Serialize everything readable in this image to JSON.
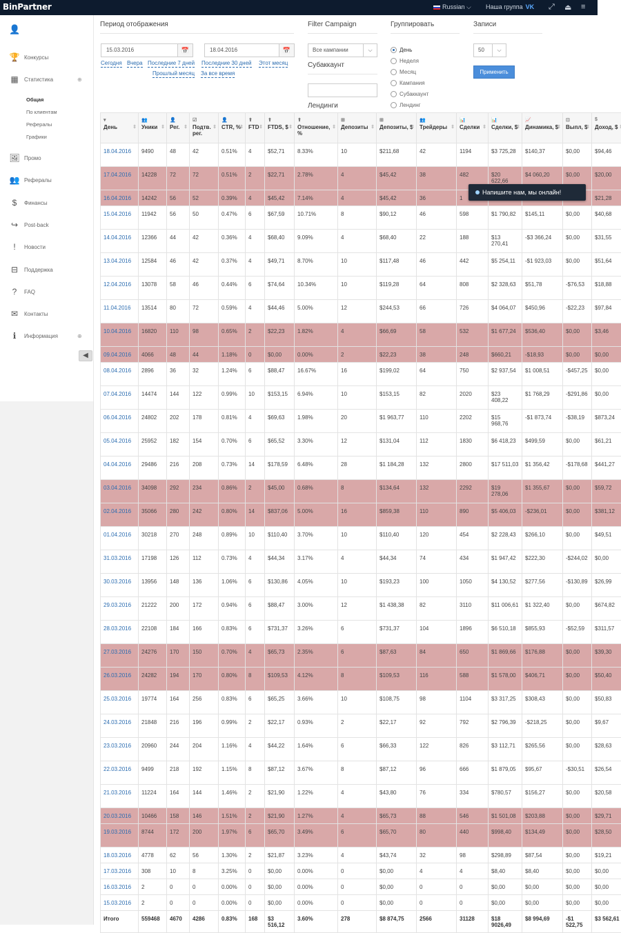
{
  "header": {
    "logo": "BinPartner",
    "language": "Russian",
    "group_label": "Наша группа",
    "vk": "VK"
  },
  "icons": {
    "fullscreen": "expand-icon",
    "logout": "logout-icon",
    "menu": "hamburger-icon"
  },
  "sidebar": {
    "items": [
      {
        "label": "Конкурсы",
        "icon": "trophy-icon",
        "glyph": "🏆"
      },
      {
        "label": "Статистика",
        "icon": "table-icon",
        "glyph": "▦",
        "expandable": "⊕"
      },
      {
        "label": "Промо",
        "icon": "image-icon",
        "glyph": "🖼"
      },
      {
        "label": "Рефералы",
        "icon": "users-icon",
        "glyph": "👥"
      },
      {
        "label": "Финансы",
        "icon": "dollar-icon",
        "glyph": "$"
      },
      {
        "label": "Post-back",
        "icon": "share-icon",
        "glyph": "↪"
      },
      {
        "label": "Новости",
        "icon": "exclamation-icon",
        "glyph": "!"
      },
      {
        "label": "Поддержка",
        "icon": "inbox-icon",
        "glyph": "⊟"
      },
      {
        "label": "FAQ",
        "icon": "question-icon",
        "glyph": "?"
      },
      {
        "label": "Контакты",
        "icon": "envelope-icon",
        "glyph": "✉"
      },
      {
        "label": "Информация",
        "icon": "info-icon",
        "glyph": "ℹ",
        "expandable": "⊕"
      }
    ],
    "subitems": [
      "Общая",
      "По клиентам",
      "Рефералы",
      "Графики"
    ],
    "collapse_glyph": "◀"
  },
  "filters": {
    "period_label": "Период отображения",
    "date_from": "15.03.2016",
    "date_to": "18.04.2016",
    "calendar_glyph": "📅",
    "period_links": [
      "Сегодня",
      "Вчера",
      "Последние 7 дней",
      "Последние 30 дней",
      "Этот месяц",
      "Прошлый месяц",
      "За все время"
    ],
    "campaign_label": "Filter Campaign",
    "campaign_value": "Все кампании",
    "subaccount_label": "Субаккаунт",
    "landing_label": "Лендинги",
    "group_label": "Группировать",
    "group_options": [
      "День",
      "Неделя",
      "Месяц",
      "Кампания",
      "Субаккаунт",
      "Лендинг"
    ],
    "group_selected": "День",
    "records_label": "Записи",
    "records_value": "50",
    "apply_label": "Применить"
  },
  "chat": {
    "label": "Напишите нам, мы онлайн!"
  },
  "table": {
    "columns": [
      {
        "label": "День",
        "icon": "▾"
      },
      {
        "label": "Уники",
        "icon": "👥"
      },
      {
        "label": "Рег.",
        "icon": "👤"
      },
      {
        "label": "Подтв. рег.",
        "icon": "☑"
      },
      {
        "label": "CTR, %",
        "icon": "👤"
      },
      {
        "label": "FTD",
        "icon": "⬆"
      },
      {
        "label": "FTDS, $",
        "icon": "⬆"
      },
      {
        "label": "Отношение, %",
        "icon": "⬆"
      },
      {
        "label": "Депозиты",
        "icon": "⊞"
      },
      {
        "label": "Депозиты, $",
        "icon": "⊞"
      },
      {
        "label": "Трейдеры",
        "icon": "👥"
      },
      {
        "label": "Сделки",
        "icon": "📊"
      },
      {
        "label": "Сделки, $",
        "icon": "📊"
      },
      {
        "label": "Динамика, $",
        "icon": "📈"
      },
      {
        "label": "Выпл, $",
        "icon": "⊡"
      },
      {
        "label": "Доход, $",
        "icon": "$"
      }
    ],
    "rows": [
      {
        "red": false,
        "cells": [
          "18.04.2016",
          "9490",
          "48",
          "42",
          "0.51%",
          "4",
          "$52,71",
          "8.33%",
          "10",
          "$211,68",
          "42",
          "1194",
          "$3 725,28",
          "$140,37",
          "$0,00",
          "$94,46"
        ]
      },
      {
        "red": true,
        "cells": [
          "17.04.2016",
          "14228",
          "72",
          "72",
          "0.51%",
          "2",
          "$22,71",
          "2.78%",
          "4",
          "$45,42",
          "38",
          "482",
          "$20 622,66",
          "$4 060,20",
          "$0,00",
          "$20,00"
        ]
      },
      {
        "red": true,
        "cells": [
          "16.04.2016",
          "14242",
          "56",
          "52",
          "0.39%",
          "4",
          "$45,42",
          "7.14%",
          "4",
          "$45,42",
          "36",
          "1",
          "",
          "",
          "",
          "$21,28"
        ]
      },
      {
        "red": false,
        "cells": [
          "15.04.2016",
          "11942",
          "56",
          "50",
          "0.47%",
          "6",
          "$67,59",
          "10.71%",
          "8",
          "$90,12",
          "46",
          "598",
          "$1 790,82",
          "$145,11",
          "$0,00",
          "$40,68"
        ]
      },
      {
        "red": false,
        "cells": [
          "14.04.2016",
          "12366",
          "44",
          "42",
          "0.36%",
          "4",
          "$68,40",
          "9.09%",
          "4",
          "$68,40",
          "22",
          "188",
          "$13 270,41",
          "-$3 366,24",
          "$0,00",
          "$31,55"
        ]
      },
      {
        "red": false,
        "cells": [
          "13.04.2016",
          "12584",
          "46",
          "42",
          "0.37%",
          "4",
          "$49,71",
          "8.70%",
          "10",
          "$117,48",
          "46",
          "442",
          "$5 254,11",
          "-$1 923,03",
          "$0,00",
          "$51,64"
        ]
      },
      {
        "red": false,
        "cells": [
          "12.04.2016",
          "13078",
          "58",
          "46",
          "0.44%",
          "6",
          "$74,64",
          "10.34%",
          "10",
          "$119,28",
          "64",
          "808",
          "$2 328,63",
          "$51,78",
          "-$76,53",
          "$18,88"
        ]
      },
      {
        "red": false,
        "cells": [
          "11.04.2016",
          "13514",
          "80",
          "72",
          "0.59%",
          "4",
          "$44,46",
          "5.00%",
          "12",
          "$244,53",
          "66",
          "726",
          "$4 064,07",
          "$450,96",
          "-$22,23",
          "$97,84"
        ]
      },
      {
        "red": true,
        "cells": [
          "10.04.2016",
          "16820",
          "110",
          "98",
          "0.65%",
          "2",
          "$22,23",
          "1.82%",
          "4",
          "$66,69",
          "58",
          "532",
          "$1 677,24",
          "$536,40",
          "$0,00",
          "$3,46"
        ]
      },
      {
        "red": true,
        "cells": [
          "09.04.2016",
          "4066",
          "48",
          "44",
          "1.18%",
          "0",
          "$0,00",
          "0.00%",
          "2",
          "$22,23",
          "38",
          "248",
          "$660,21",
          "-$18,93",
          "$0,00",
          "$0,00"
        ]
      },
      {
        "red": false,
        "cells": [
          "08.04.2016",
          "2896",
          "36",
          "32",
          "1.24%",
          "6",
          "$88,47",
          "16.67%",
          "16",
          "$199,02",
          "64",
          "750",
          "$2 937,54",
          "$1 008,51",
          "-$457,25",
          "$0,00"
        ]
      },
      {
        "red": false,
        "cells": [
          "07.04.2016",
          "14474",
          "144",
          "122",
          "0.99%",
          "10",
          "$153,15",
          "6.94%",
          "10",
          "$153,15",
          "82",
          "2020",
          "$23 408,22",
          "$1 768,29",
          "-$291,86",
          "$0,00"
        ]
      },
      {
        "red": false,
        "cells": [
          "06.04.2016",
          "24802",
          "202",
          "178",
          "0.81%",
          "4",
          "$69,63",
          "1.98%",
          "20",
          "$1 963,77",
          "110",
          "2202",
          "$15 968,76",
          "-$1 873,74",
          "-$38,19",
          "$873,24"
        ]
      },
      {
        "red": false,
        "cells": [
          "05.04.2016",
          "25952",
          "182",
          "154",
          "0.70%",
          "6",
          "$65,52",
          "3.30%",
          "12",
          "$131,04",
          "112",
          "1830",
          "$6 418,23",
          "$499,59",
          "$0,00",
          "$61,21"
        ]
      },
      {
        "red": false,
        "cells": [
          "04.04.2016",
          "29486",
          "216",
          "208",
          "0.73%",
          "14",
          "$178,59",
          "6.48%",
          "28",
          "$1 184,28",
          "132",
          "2800",
          "$17 511,03",
          "$1 356,42",
          "-$178,68",
          "$441,27"
        ]
      },
      {
        "red": true,
        "cells": [
          "03.04.2016",
          "34098",
          "292",
          "234",
          "0.86%",
          "2",
          "$45,00",
          "0.68%",
          "8",
          "$134,64",
          "132",
          "2292",
          "$19 278,06",
          "$1 355,67",
          "$0,00",
          "$59,72"
        ]
      },
      {
        "red": true,
        "cells": [
          "02.04.2016",
          "35066",
          "280",
          "242",
          "0.80%",
          "14",
          "$837,06",
          "5.00%",
          "16",
          "$859,38",
          "110",
          "890",
          "$5 406,03",
          "-$236,01",
          "$0,00",
          "$381,12"
        ]
      },
      {
        "red": false,
        "cells": [
          "01.04.2016",
          "30218",
          "270",
          "248",
          "0.89%",
          "10",
          "$110,40",
          "3.70%",
          "10",
          "$110,40",
          "120",
          "454",
          "$2 228,43",
          "$266,10",
          "$0,00",
          "$49,51"
        ]
      },
      {
        "red": false,
        "cells": [
          "31.03.2016",
          "17198",
          "126",
          "112",
          "0.73%",
          "4",
          "$44,34",
          "3.17%",
          "4",
          "$44,34",
          "74",
          "434",
          "$1 947,42",
          "$222,30",
          "-$244,02",
          "$0,00"
        ]
      },
      {
        "red": false,
        "cells": [
          "30.03.2016",
          "13956",
          "148",
          "136",
          "1.06%",
          "6",
          "$130,86",
          "4.05%",
          "10",
          "$193,23",
          "100",
          "1050",
          "$4 130,52",
          "$277,56",
          "-$130,89",
          "$26,99"
        ]
      },
      {
        "red": false,
        "cells": [
          "29.03.2016",
          "21222",
          "200",
          "172",
          "0.94%",
          "6",
          "$88,47",
          "3.00%",
          "12",
          "$1 438,38",
          "82",
          "3110",
          "$11 006,61",
          "$1 322,40",
          "$0,00",
          "$674,82"
        ]
      },
      {
        "red": false,
        "cells": [
          "28.03.2016",
          "22108",
          "184",
          "166",
          "0.83%",
          "6",
          "$731,37",
          "3.26%",
          "6",
          "$731,37",
          "104",
          "1896",
          "$6 510,18",
          "$855,93",
          "-$52,59",
          "$311,57"
        ]
      },
      {
        "red": true,
        "cells": [
          "27.03.2016",
          "24276",
          "170",
          "150",
          "0.70%",
          "4",
          "$65,73",
          "2.35%",
          "6",
          "$87,63",
          "84",
          "650",
          "$1 869,66",
          "$176,88",
          "$0,00",
          "$39,30"
        ]
      },
      {
        "red": true,
        "cells": [
          "26.03.2016",
          "24282",
          "194",
          "170",
          "0.80%",
          "8",
          "$109,53",
          "4.12%",
          "8",
          "$109,53",
          "116",
          "588",
          "$1 578,00",
          "$406,71",
          "$0,00",
          "$50,40"
        ]
      },
      {
        "red": false,
        "cells": [
          "25.03.2016",
          "19774",
          "164",
          "256",
          "0.83%",
          "6",
          "$65,25",
          "3.66%",
          "10",
          "$108,75",
          "98",
          "1104",
          "$3 317,25",
          "$308,43",
          "$0,00",
          "$50,83"
        ]
      },
      {
        "red": false,
        "cells": [
          "24.03.2016",
          "21848",
          "216",
          "196",
          "0.99%",
          "2",
          "$22,17",
          "0.93%",
          "2",
          "$22,17",
          "92",
          "792",
          "$2 796,39",
          "-$218,25",
          "$0,00",
          "$9,67"
        ]
      },
      {
        "red": false,
        "cells": [
          "23.03.2016",
          "20960",
          "244",
          "204",
          "1.16%",
          "4",
          "$44,22",
          "1.64%",
          "6",
          "$66,33",
          "122",
          "826",
          "$3 112,71",
          "$265,56",
          "$0,00",
          "$28,63"
        ]
      },
      {
        "red": false,
        "cells": [
          "22.03.2016",
          "9499",
          "218",
          "192",
          "1.15%",
          "8",
          "$87,12",
          "3.67%",
          "8",
          "$87,12",
          "96",
          "666",
          "$1 879,05",
          "$95,67",
          "-$30,51",
          "$26,54"
        ]
      },
      {
        "red": false,
        "cells": [
          "21.03.2016",
          "11224",
          "164",
          "144",
          "1.46%",
          "2",
          "$21,90",
          "1.22%",
          "4",
          "$43,80",
          "76",
          "334",
          "$780,57",
          "$156,27",
          "$0,00",
          "$20,58"
        ]
      },
      {
        "red": true,
        "cells": [
          "20.03.2016",
          "10466",
          "158",
          "146",
          "1.51%",
          "2",
          "$21,90",
          "1.27%",
          "4",
          "$65,73",
          "88",
          "546",
          "$1 501,08",
          "$203,88",
          "$0,00",
          "$29,71"
        ]
      },
      {
        "red": true,
        "cells": [
          "19.03.2016",
          "8744",
          "172",
          "200",
          "1.97%",
          "6",
          "$65,70",
          "3.49%",
          "6",
          "$65,70",
          "80",
          "440",
          "$998,40",
          "$134,49",
          "$0,00",
          "$28,50"
        ]
      },
      {
        "red": false,
        "cells": [
          "18.03.2016",
          "4778",
          "62",
          "56",
          "1.30%",
          "2",
          "$21,87",
          "3.23%",
          "4",
          "$43,74",
          "32",
          "98",
          "$298,89",
          "$87,54",
          "$0,00",
          "$19,21"
        ]
      },
      {
        "red": false,
        "cells": [
          "17.03.2016",
          "308",
          "10",
          "8",
          "3.25%",
          "0",
          "$0,00",
          "0.00%",
          "0",
          "$0,00",
          "4",
          "4",
          "$8,40",
          "$8,40",
          "$0,00",
          "$0,00"
        ]
      },
      {
        "red": false,
        "cells": [
          "16.03.2016",
          "2",
          "0",
          "0",
          "0.00%",
          "0",
          "$0,00",
          "0.00%",
          "0",
          "$0,00",
          "0",
          "0",
          "$0,00",
          "$0,00",
          "$0,00",
          "$0,00"
        ]
      },
      {
        "red": false,
        "cells": [
          "15.03.2016",
          "2",
          "0",
          "0",
          "0.00%",
          "0",
          "$0,00",
          "0.00%",
          "0",
          "$0,00",
          "0",
          "0",
          "$0,00",
          "$0,00",
          "$0,00",
          "$0,00"
        ]
      }
    ],
    "total": [
      "Итого",
      "559468",
      "4670",
      "4286",
      "0.83%",
      "168",
      "$3 516,12",
      "3.60%",
      "278",
      "$8 874,75",
      "2566",
      "31128",
      "$18 9026,49",
      "$8 994,69",
      "-$1 522,75",
      "$3 562,61"
    ]
  }
}
